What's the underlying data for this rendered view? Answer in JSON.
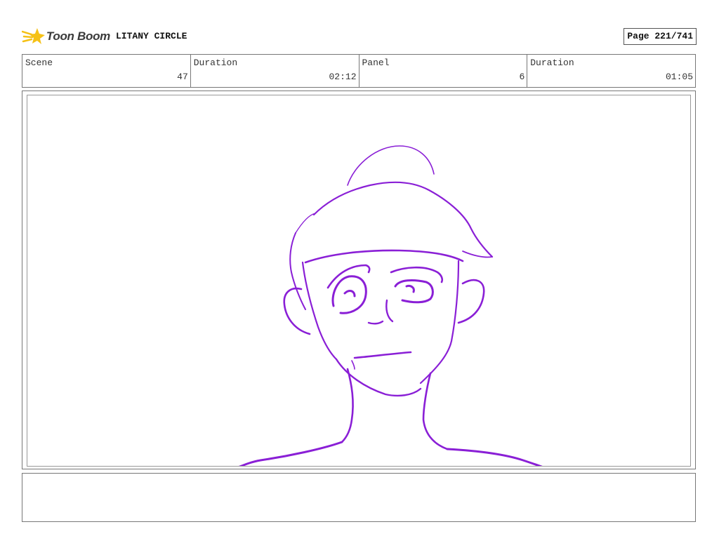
{
  "header": {
    "logo_text": "Toon Boom",
    "project_title": "LITANY CIRCLE",
    "page_label": "Page 221/741"
  },
  "info": {
    "scene_label": "Scene",
    "scene_value": "47",
    "scene_duration_label": "Duration",
    "scene_duration_value": "02:12",
    "panel_label": "Panel",
    "panel_value": "6",
    "panel_duration_label": "Duration",
    "panel_duration_value": "01:05"
  },
  "panel": {
    "sketch_icon": "character-face-sketch",
    "sketch_color": "#8a1fd6"
  },
  "notes": {
    "text": ""
  },
  "colors": {
    "logo_yellow": "#f5c116",
    "border": "#777777"
  }
}
